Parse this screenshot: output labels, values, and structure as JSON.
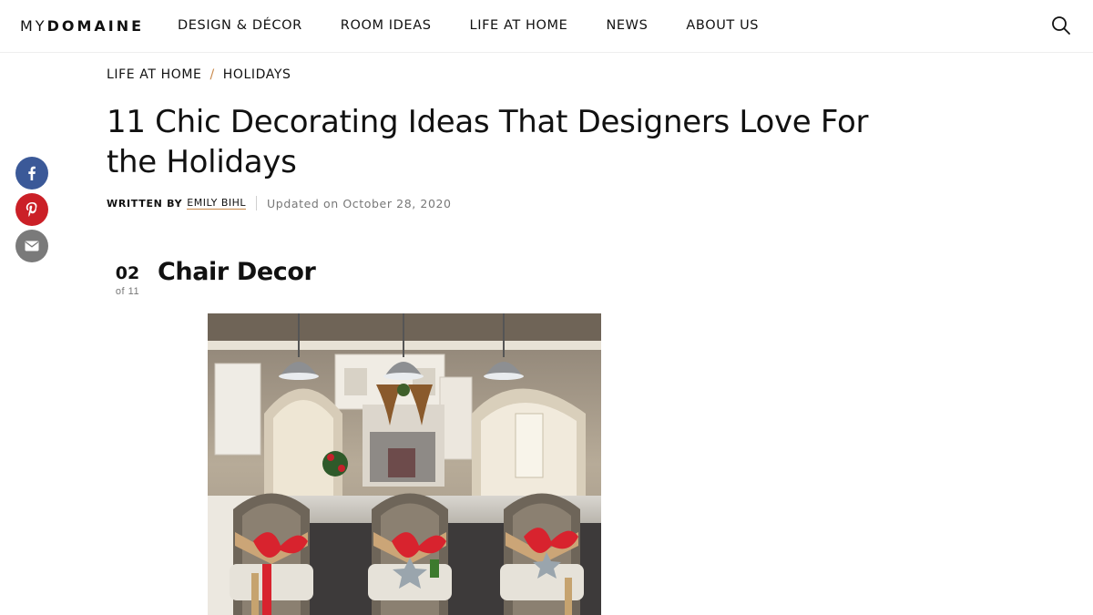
{
  "logo": {
    "my": "MY",
    "domaine": "DOMAINE"
  },
  "nav": [
    "DESIGN & DÉCOR",
    "ROOM IDEAS",
    "LIFE AT HOME",
    "NEWS",
    "ABOUT US"
  ],
  "breadcrumb": {
    "first": "LIFE AT HOME",
    "separator": "/",
    "second": "HOLIDAYS"
  },
  "article": {
    "title": "11 Chic Decorating Ideas That Designers Love For the Holidays",
    "written_by": "WRITTEN BY",
    "author": "EMILY BIHL",
    "updated": "Updated on October 28, 2020"
  },
  "item": {
    "number": "02",
    "of": "of 11",
    "title": "Chair Decor"
  },
  "colors": {
    "accent": "#c8884a",
    "facebook": "#3b5998",
    "pinterest": "#cb2027",
    "email": "#7a7a7a"
  },
  "icons": {
    "search": "search-icon",
    "share": [
      "facebook-icon",
      "pinterest-icon",
      "email-icon"
    ]
  }
}
